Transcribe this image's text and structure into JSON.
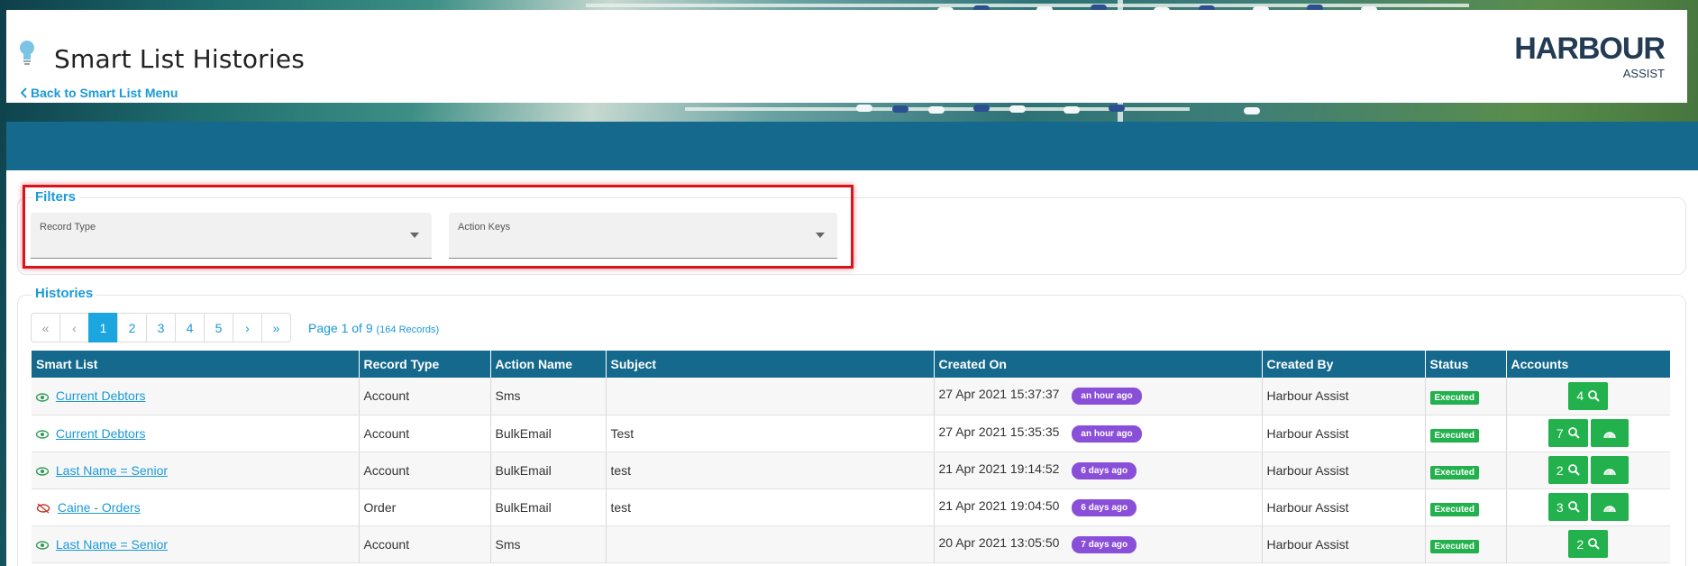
{
  "header": {
    "title": "Smart List Histories",
    "back_link": "Back to Smart List Menu"
  },
  "logo": {
    "word": "HARBOUR",
    "sub": "ASSIST"
  },
  "filters": {
    "legend": "Filters",
    "record_type_label": "Record Type",
    "action_keys_label": "Action Keys"
  },
  "histories": {
    "legend": "Histories",
    "pager": {
      "first": "«",
      "prev": "‹",
      "pages": [
        "1",
        "2",
        "3",
        "4",
        "5"
      ],
      "next": "›",
      "last": "»",
      "active_page": "1",
      "info": "Page 1 of 9",
      "records": "(164 Records)"
    },
    "columns": [
      "Smart List",
      "Record Type",
      "Action Name",
      "Subject",
      "Created On",
      "Created By",
      "Status",
      "Accounts"
    ],
    "rows": [
      {
        "smart_list": "Current Debtors",
        "visible": true,
        "record_type": "Account",
        "action_name": "Sms",
        "subject": "",
        "created_on": "27 Apr 2021 15:37:37",
        "ago": "an hour ago",
        "created_by": "Harbour Assist",
        "status": "Executed",
        "accounts": "4",
        "has_gauge": false
      },
      {
        "smart_list": "Current Debtors",
        "visible": true,
        "record_type": "Account",
        "action_name": "BulkEmail",
        "subject": "Test",
        "created_on": "27 Apr 2021 15:35:35",
        "ago": "an hour ago",
        "created_by": "Harbour Assist",
        "status": "Executed",
        "accounts": "7",
        "has_gauge": true
      },
      {
        "smart_list": "Last Name = Senior",
        "visible": true,
        "record_type": "Account",
        "action_name": "BulkEmail",
        "subject": "test",
        "created_on": "21 Apr 2021 19:14:52",
        "ago": "6 days ago",
        "created_by": "Harbour Assist",
        "status": "Executed",
        "accounts": "2",
        "has_gauge": true
      },
      {
        "smart_list": "Caine - Orders",
        "visible": false,
        "record_type": "Order",
        "action_name": "BulkEmail",
        "subject": "test",
        "created_on": "21 Apr 2021 19:04:50",
        "ago": "6 days ago",
        "created_by": "Harbour Assist",
        "status": "Executed",
        "accounts": "3",
        "has_gauge": true
      },
      {
        "smart_list": "Last Name = Senior",
        "visible": true,
        "record_type": "Account",
        "action_name": "Sms",
        "subject": "",
        "created_on": "20 Apr 2021 13:05:50",
        "ago": "7 days ago",
        "created_by": "Harbour Assist",
        "status": "Executed",
        "accounts": "2",
        "has_gauge": false
      }
    ]
  },
  "colors": {
    "accent": "#1b9ad6",
    "band": "#14698d",
    "badge_purple": "#8a4fd9",
    "status_green": "#22b14c",
    "highlight_red": "#d9141b"
  },
  "icons": [
    "lightbulb-icon",
    "chevron-left-icon",
    "eye-icon",
    "eye-slash-icon",
    "search-icon",
    "gauge-icon",
    "caret-down-icon"
  ]
}
